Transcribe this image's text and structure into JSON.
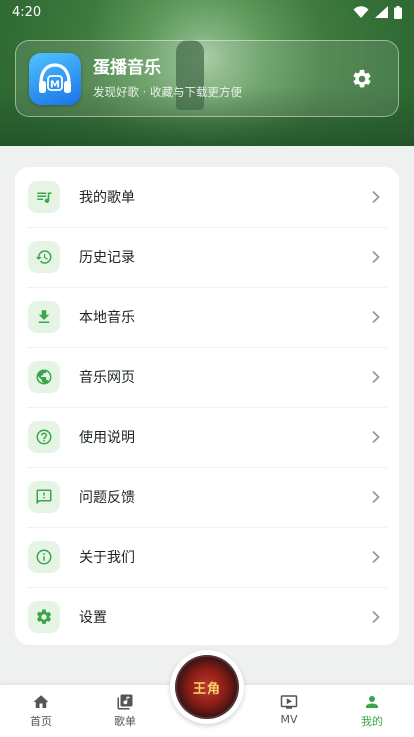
{
  "status_bar": {
    "time": "4:20"
  },
  "profile": {
    "app_name": "蛋播音乐",
    "subtitle": "发现好歌 · 收藏与下载更方便",
    "logo_text": "M"
  },
  "menu": {
    "items": [
      {
        "label": "我的歌单",
        "icon": "playlist-icon"
      },
      {
        "label": "历史记录",
        "icon": "history-icon"
      },
      {
        "label": "本地音乐",
        "icon": "download-icon"
      },
      {
        "label": "音乐网页",
        "icon": "globe-icon"
      },
      {
        "label": "使用说明",
        "icon": "help-icon"
      },
      {
        "label": "问题反馈",
        "icon": "feedback-icon"
      },
      {
        "label": "关于我们",
        "icon": "info-icon"
      },
      {
        "label": "设置",
        "icon": "gear-icon"
      }
    ]
  },
  "bottom_nav": {
    "home": "首页",
    "playlists": "歌单",
    "mv": "MV",
    "mine": "我的",
    "now_playing_title": "王角"
  },
  "colors": {
    "accent": "#3aa64a",
    "icon_bg": "#e6f4e6",
    "header_green": "#3f7a3f"
  }
}
